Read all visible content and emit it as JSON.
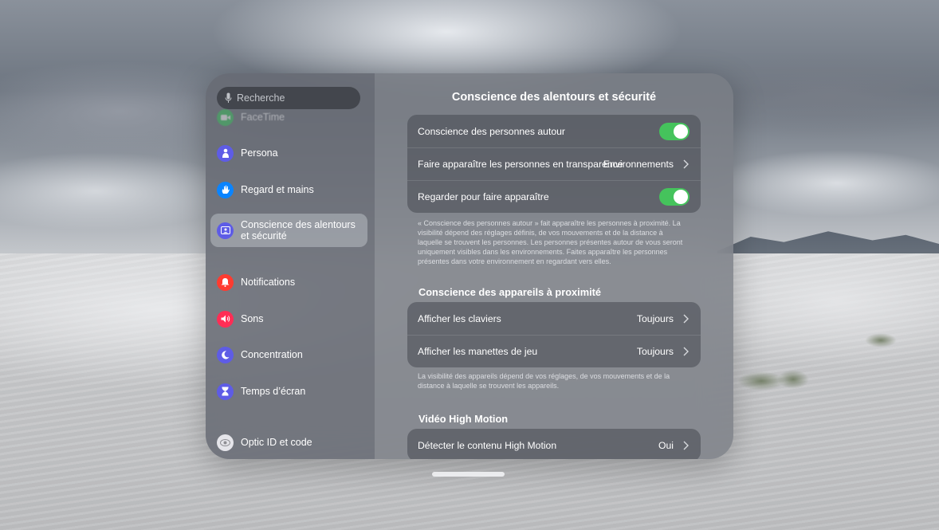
{
  "search": {
    "placeholder": "Recherche"
  },
  "sidebar": {
    "items": [
      {
        "label": "FaceTime",
        "icon": "facetime-icon",
        "color": "#34c759"
      },
      {
        "label": "Persona",
        "icon": "persona-icon",
        "color": "#5e5ce6"
      },
      {
        "label": "Regard et mains",
        "icon": "hand-icon",
        "color": "#0a84ff"
      },
      {
        "label": "Conscience des alentours\net sécurité",
        "icon": "surroundings-icon",
        "color": "#5e5ce6",
        "selected": true
      },
      {
        "label": "Notifications",
        "icon": "bell-icon",
        "color": "#ff3b30"
      },
      {
        "label": "Sons",
        "icon": "speaker-icon",
        "color": "#ff2d55"
      },
      {
        "label": "Concentration",
        "icon": "moon-icon",
        "color": "#5e5ce6"
      },
      {
        "label": "Temps d’écran",
        "icon": "hourglass-icon",
        "color": "#5e5ce6"
      },
      {
        "label": "Optic ID et code",
        "icon": "optic-id-icon",
        "color": "#e5e5ea"
      }
    ]
  },
  "content": {
    "title": "Conscience des alentours et sécurité",
    "group1": {
      "people_awareness": {
        "label": "Conscience des personnes autour",
        "on": true
      },
      "passthrough": {
        "label": "Faire apparaître les personnes en transparence",
        "value": "Environnements"
      },
      "look_to_reveal": {
        "label": "Regarder pour faire apparaître",
        "on": true
      }
    },
    "footnote1": "« Conscience des personnes autour » fait apparaître les personnes à proximité. La visibilité dépend des réglages définis, de vos mouvements et de la distance à laquelle se trouvent les personnes. Les personnes présentes autour de vous seront uniquement visibles dans les environnements. Faites apparaître les personnes présentes dans votre environnement en regardant vers elles.",
    "section2_title": "Conscience des appareils à proximité",
    "group2": {
      "keyboards": {
        "label": "Afficher les claviers",
        "value": "Toujours"
      },
      "controllers": {
        "label": "Afficher les manettes de jeu",
        "value": "Toujours"
      }
    },
    "footnote2": "La visibilité des appareils dépend de vos réglages, de vos mouvements et de la distance à laquelle se trouvent les appareils.",
    "section3_title": "Vidéo High Motion",
    "group3": {
      "detect": {
        "label": "Détecter le contenu High Motion",
        "value": "Oui"
      }
    }
  },
  "colors": {
    "toggle_on": "#45c35c"
  }
}
